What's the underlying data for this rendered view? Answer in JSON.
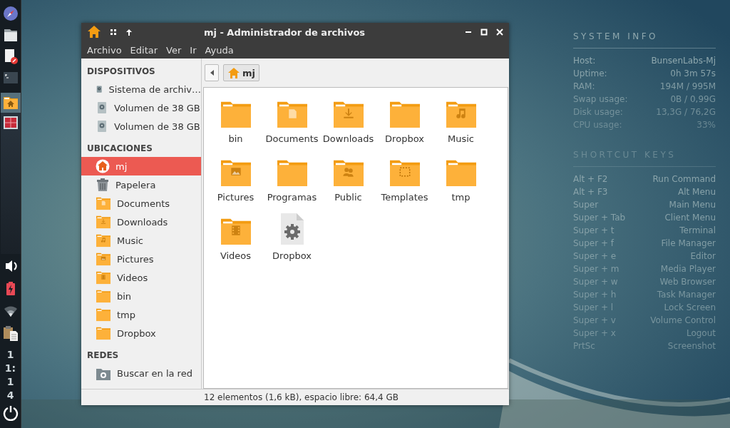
{
  "panel": {
    "tasks": [
      {
        "selected": true
      },
      {
        "selected": false
      }
    ],
    "clock": [
      "1",
      "1:",
      "1",
      "4"
    ]
  },
  "window": {
    "title": "mj - Administrador de archivos",
    "menu": [
      "Archivo",
      "Editar",
      "Ver",
      "Ir",
      "Ayuda"
    ],
    "sidebar": [
      {
        "heading": "DISPOSITIVOS",
        "items": [
          {
            "label": "Sistema de archiv…",
            "kind": "drive",
            "selected": false
          },
          {
            "label": "Volumen de 38 GB",
            "kind": "removable",
            "selected": false
          },
          {
            "label": "Volumen de 38 GB",
            "kind": "removable",
            "selected": false
          }
        ]
      },
      {
        "heading": "UBICACIONES",
        "items": [
          {
            "label": "mj",
            "kind": "home",
            "selected": true
          },
          {
            "label": "Papelera",
            "kind": "trash",
            "selected": false
          },
          {
            "label": "Documents",
            "kind": "doc",
            "selected": false
          },
          {
            "label": "Downloads",
            "kind": "download",
            "selected": false
          },
          {
            "label": "Music",
            "kind": "music",
            "selected": false
          },
          {
            "label": "Pictures",
            "kind": "picture",
            "selected": false
          },
          {
            "label": "Videos",
            "kind": "video",
            "selected": false
          },
          {
            "label": "bin",
            "kind": "folder",
            "selected": false
          },
          {
            "label": "tmp",
            "kind": "folder",
            "selected": false
          },
          {
            "label": "Dropbox",
            "kind": "folder",
            "selected": false
          }
        ]
      },
      {
        "heading": "REDES",
        "items": [
          {
            "label": "Buscar en la red",
            "kind": "network",
            "selected": false
          }
        ]
      }
    ],
    "path": "mj",
    "files": [
      {
        "name": "bin",
        "kind": "folder"
      },
      {
        "name": "Documents",
        "kind": "doc"
      },
      {
        "name": "Downloads",
        "kind": "download"
      },
      {
        "name": "Dropbox",
        "kind": "folder"
      },
      {
        "name": "Music",
        "kind": "music"
      },
      {
        "name": "Pictures",
        "kind": "picture"
      },
      {
        "name": "Programas",
        "kind": "folder"
      },
      {
        "name": "Public",
        "kind": "people"
      },
      {
        "name": "Templates",
        "kind": "template"
      },
      {
        "name": "tmp",
        "kind": "folder"
      },
      {
        "name": "Videos",
        "kind": "video"
      },
      {
        "name": "Dropbox",
        "kind": "file"
      }
    ],
    "status": "12 elementos (1,6 kB), espacio libre: 64,4 GB"
  },
  "conky": {
    "title": "SYSTEM INFO",
    "info": [
      [
        "Host:",
        "BunsenLabs-Mj"
      ],
      [
        "Uptime:",
        "0h 3m 57s"
      ],
      [
        "RAM:",
        "194M / 995M"
      ],
      [
        "Swap usage:",
        "0B / 0,99G"
      ],
      [
        "Disk usage:",
        "13,3G / 76,2G"
      ],
      [
        "CPU usage:",
        "33%"
      ]
    ],
    "shortcuts_title": "SHORTCUT KEYS",
    "shortcuts": [
      [
        "Alt + F2",
        "Run Command"
      ],
      [
        "Alt + F3",
        "Alt Menu"
      ],
      [
        "Super",
        "Main Menu"
      ],
      [
        "Super + Tab",
        "Client Menu"
      ],
      [
        "Super + t",
        "Terminal"
      ],
      [
        "Super + f",
        "File Manager"
      ],
      [
        "Super + e",
        "Editor"
      ],
      [
        "Super + m",
        "Media Player"
      ],
      [
        "Super + w",
        "Web Browser"
      ],
      [
        "Super + h",
        "Task Manager"
      ],
      [
        "Super + l",
        "Lock Screen"
      ],
      [
        "Super + v",
        "Volume Control"
      ],
      [
        "Super + x",
        "Logout"
      ],
      [
        "PrtSc",
        "Screenshot"
      ]
    ]
  }
}
